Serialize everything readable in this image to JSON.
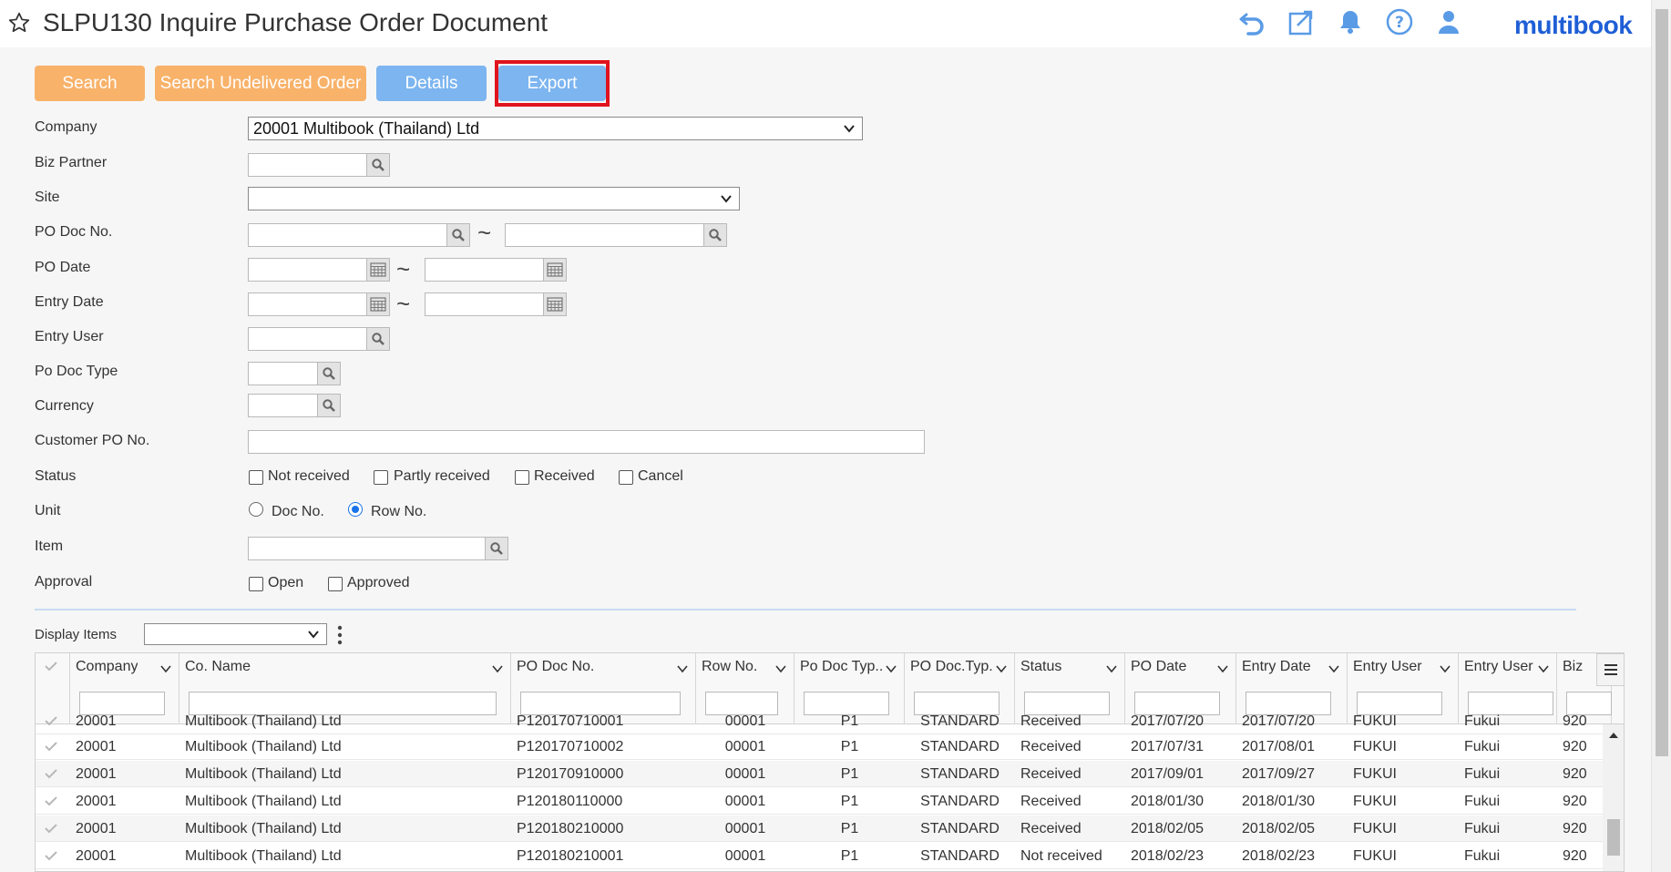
{
  "header": {
    "title": "SLPU130 Inquire Purchase Order Document",
    "brand": "multibook",
    "icons": [
      "star-icon",
      "undo-icon",
      "popout-icon",
      "bell-icon",
      "help-icon",
      "user-icon"
    ],
    "accent_color": "#1f5fd6"
  },
  "toolbar": {
    "search": "Search",
    "search_undelivered": "Search Undelivered Order",
    "details": "Details",
    "export": "Export"
  },
  "form": {
    "company_label": "Company",
    "company_value": "20001 Multibook (Thailand) Ltd",
    "biz_partner_label": "Biz Partner",
    "site_label": "Site",
    "po_doc_no_label": "PO Doc No.",
    "po_date_label": "PO Date",
    "entry_date_label": "Entry Date",
    "entry_user_label": "Entry User",
    "po_doc_type_label": "Po Doc Type",
    "currency_label": "Currency",
    "customer_po_label": "Customer PO No.",
    "status_label": "Status",
    "status_options": [
      "Not received",
      "Partly received",
      "Received",
      "Cancel"
    ],
    "unit_label": "Unit",
    "unit_options": [
      "Doc No.",
      "Row No."
    ],
    "unit_selected": "Row No.",
    "item_label": "Item",
    "approval_label": "Approval",
    "approval_options": [
      "Open",
      "Approved"
    ],
    "range_sep": "~"
  },
  "grid": {
    "display_items_label": "Display Items",
    "columns": [
      "Company",
      "Co. Name",
      "PO Doc No.",
      "Row No.",
      "Po Doc Typ...",
      "PO Doc.Typ...",
      "Status",
      "PO Date",
      "Entry Date",
      "Entry User",
      "Entry User ...",
      "Biz"
    ],
    "partial_row": [
      "20001",
      "Multibook (Thailand) Ltd",
      "P120170710001",
      "00001",
      "P1",
      "STANDARD",
      "Received",
      "2017/07/20",
      "2017/07/20",
      "FUKUI",
      "Fukui",
      "920"
    ],
    "rows": [
      [
        "20001",
        "Multibook (Thailand) Ltd",
        "P120170710002",
        "00001",
        "P1",
        "STANDARD",
        "Received",
        "2017/07/31",
        "2017/08/01",
        "FUKUI",
        "Fukui",
        "920"
      ],
      [
        "20001",
        "Multibook (Thailand) Ltd",
        "P120170910000",
        "00001",
        "P1",
        "STANDARD",
        "Received",
        "2017/09/01",
        "2017/09/27",
        "FUKUI",
        "Fukui",
        "920"
      ],
      [
        "20001",
        "Multibook (Thailand) Ltd",
        "P120180110000",
        "00001",
        "P1",
        "STANDARD",
        "Received",
        "2018/01/30",
        "2018/01/30",
        "FUKUI",
        "Fukui",
        "920"
      ],
      [
        "20001",
        "Multibook (Thailand) Ltd",
        "P120180210000",
        "00001",
        "P1",
        "STANDARD",
        "Received",
        "2018/02/05",
        "2018/02/05",
        "FUKUI",
        "Fukui",
        "920"
      ],
      [
        "20001",
        "Multibook (Thailand) Ltd",
        "P120180210001",
        "00001",
        "P1",
        "STANDARD",
        "Not received",
        "2018/02/23",
        "2018/02/23",
        "FUKUI",
        "Fukui",
        "920"
      ]
    ]
  }
}
